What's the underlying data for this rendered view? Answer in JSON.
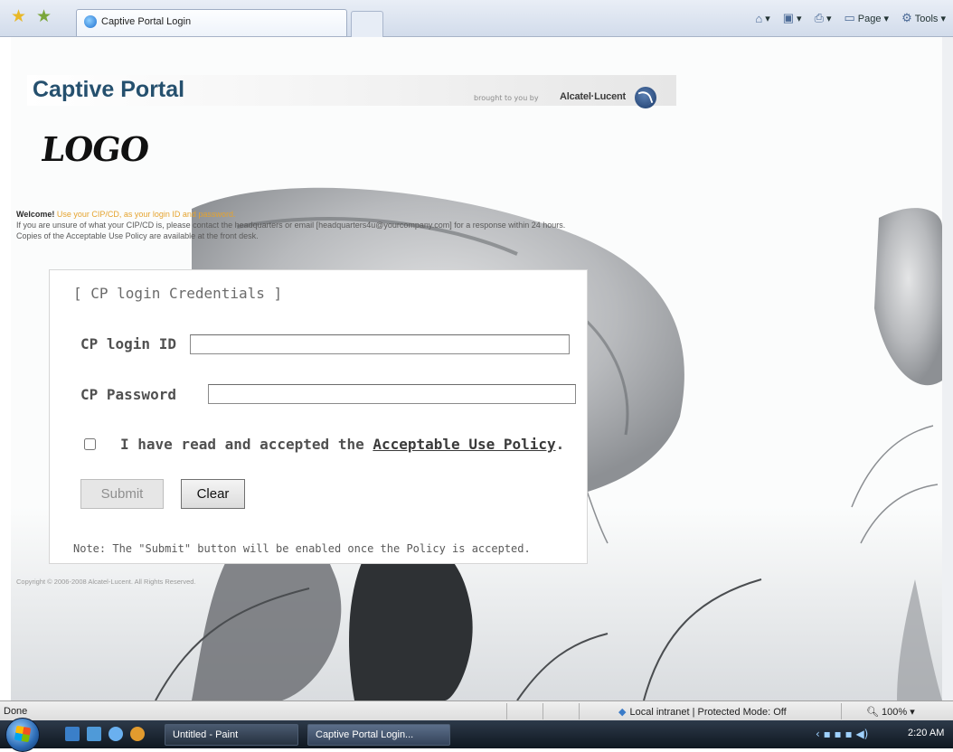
{
  "browser": {
    "tab_title": "Captive Portal Login",
    "commands": [
      {
        "icon": "home-icon",
        "label": "▾"
      },
      {
        "icon": "feeds-icon",
        "label": "▾"
      },
      {
        "icon": "print-icon",
        "label": "▾"
      },
      {
        "icon": "page-icon",
        "label": "Page ▾"
      },
      {
        "icon": "tools-icon",
        "label": "Tools ▾"
      }
    ]
  },
  "header": {
    "title": "Captive Portal",
    "brought_by": "brought to you by",
    "brand": "Alcatel·Lucent"
  },
  "logo_text": "LOGO",
  "welcome": {
    "lead": "Welcome!",
    "highlight": "Use your CIP/CD, as your login ID and password.",
    "line2": "If you are unsure of what your CIP/CD is, please contact the headquarters or email [headquarters4u@yourcompany.com] for a response within 24 hours.",
    "line3": "Copies of the Acceptable Use Policy are available at the front desk."
  },
  "login": {
    "title": "[ CP login Credentials ]",
    "id_label": "CP login ID",
    "id_value": "",
    "password_label": "CP Password",
    "password_value": "",
    "policy_prefix": "I have read and accepted the ",
    "policy_link": "Acceptable Use Policy",
    "policy_suffix": ".",
    "submit_label": "Submit",
    "clear_label": "Clear",
    "note": "Note: The \"Submit\" button will be enabled once the Policy is accepted."
  },
  "copyright": "Copyright © 2006-2008 Alcatel-Lucent. All Rights Reserved.",
  "statusbar": {
    "status": "Done",
    "zone": "Local intranet | Protected Mode: Off",
    "zoom": "100%"
  },
  "taskbar": {
    "tasks": [
      "Untitled - Paint",
      "Captive Portal Login..."
    ],
    "clock": "2:20 AM"
  },
  "colors": {
    "title_blue": "#25506e",
    "highlight_orange": "#e5a32e"
  }
}
